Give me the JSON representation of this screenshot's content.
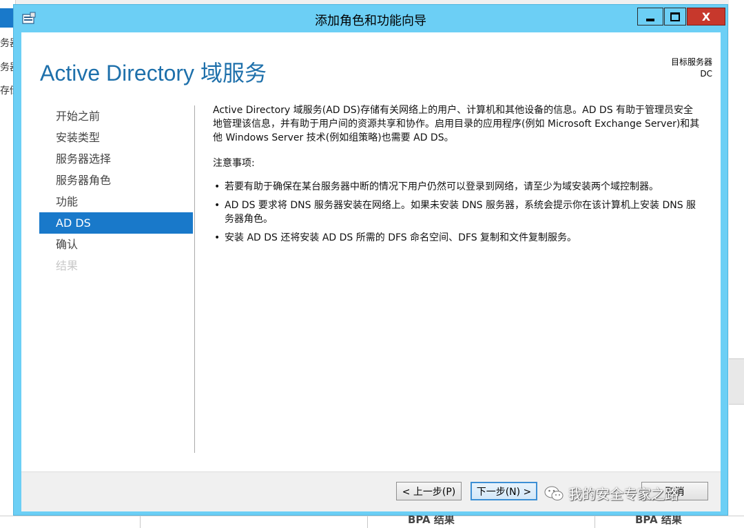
{
  "background": {
    "left_items": [
      "务器",
      "务器",
      "存储"
    ],
    "bottom_labels": [
      "BPA 结果",
      "BPA 结果"
    ]
  },
  "window": {
    "title": "添加角色和功能向导",
    "close_glyph": "X"
  },
  "header": {
    "page_title": "Active Directory 域服务",
    "target_label": "目标服务器",
    "target_value": "DC"
  },
  "nav": {
    "items": [
      {
        "label": "开始之前",
        "state": "normal"
      },
      {
        "label": "安装类型",
        "state": "normal"
      },
      {
        "label": "服务器选择",
        "state": "normal"
      },
      {
        "label": "服务器角色",
        "state": "normal"
      },
      {
        "label": "功能",
        "state": "normal"
      },
      {
        "label": "AD DS",
        "state": "selected"
      },
      {
        "label": "确认",
        "state": "normal"
      },
      {
        "label": "结果",
        "state": "disabled"
      }
    ]
  },
  "content": {
    "intro": "Active Directory 域服务(AD DS)存储有关网络上的用户、计算机和其他设备的信息。AD DS 有助于管理员安全地管理该信息，并有助于用户间的资源共享和协作。启用目录的应用程序(例如 Microsoft Exchange Server)和其他 Windows Server 技术(例如组策略)也需要 AD DS。",
    "notes_heading": "注意事项:",
    "notes": [
      "若要有助于确保在某台服务器中断的情况下用户仍然可以登录到网络，请至少为域安装两个域控制器。",
      "AD DS 要求将 DNS 服务器安装在网络上。如果未安装 DNS 服务器，系统会提示你在该计算机上安装 DNS 服务器角色。",
      "安装 AD DS 还将安装 AD DS 所需的 DFS 命名空间、DFS 复制和文件复制服务。"
    ]
  },
  "footer": {
    "prev_label": "< 上一步(P)",
    "next_label": "下一步(N) >",
    "cancel_label": "取消",
    "watermark": "我的安全专家之路"
  },
  "colors": {
    "frame": "#6ccff5",
    "accent": "#1979ca",
    "title_text": "#1e70ab",
    "close": "#c7382c"
  }
}
